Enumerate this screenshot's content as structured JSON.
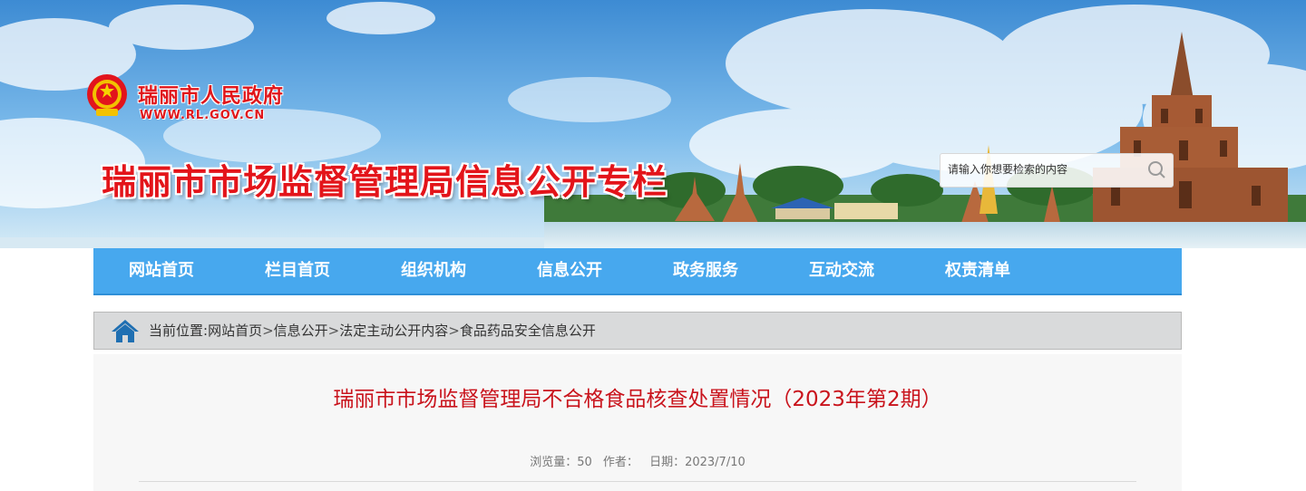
{
  "header": {
    "site_name": "瑞丽市人民政府",
    "site_url": "WWW.RL.GOV.CN",
    "banner_title": "瑞丽市市场监督管理局信息公开专栏",
    "search": {
      "placeholder": "请输入你想要检索的内容"
    }
  },
  "nav": {
    "items": [
      {
        "label": "网站首页"
      },
      {
        "label": "栏目首页"
      },
      {
        "label": "组织机构"
      },
      {
        "label": "信息公开"
      },
      {
        "label": "政务服务"
      },
      {
        "label": "互动交流"
      },
      {
        "label": "权责清单"
      }
    ]
  },
  "breadcrumb": {
    "prefix": "当前位置:",
    "items": [
      "网站首页",
      "信息公开",
      "法定主动公开内容",
      "食品药品安全信息公开"
    ],
    "separator": ">"
  },
  "article": {
    "title": "瑞丽市市场监督管理局不合格食品核查处置情况（2023年第2期）",
    "views_label": "浏览量：",
    "views": "50",
    "author_label": "作者：",
    "date_label": "日期：",
    "date": "2023/7/10"
  },
  "colors": {
    "accent_red": "#e3141a",
    "nav_blue": "#47a8ee",
    "title_red": "#c9131c"
  }
}
